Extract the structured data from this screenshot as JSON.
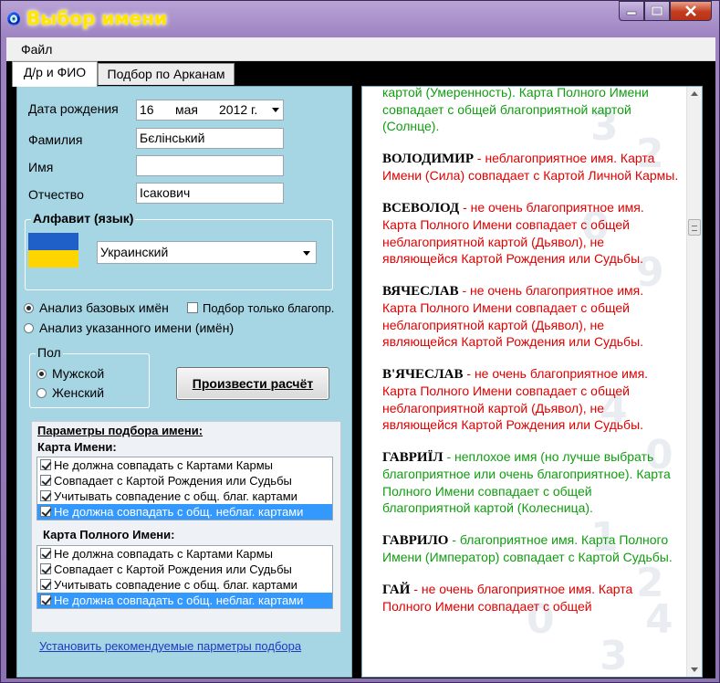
{
  "window": {
    "title": "Выбор имени",
    "icons": [
      "app-icon",
      "minimize-icon",
      "maximize-icon",
      "close-icon"
    ]
  },
  "menu": {
    "file": "Файл"
  },
  "tabs": [
    {
      "label": "Д/р и ФИО",
      "active": true
    },
    {
      "label": "Подбор по Арканам",
      "active": false
    }
  ],
  "form": {
    "birth_date_label": "Дата рождения",
    "birth_day": "16",
    "birth_month": "мая",
    "birth_year": "2012 г.",
    "surname_label": "Фамилия",
    "surname_value": "Бєлінський",
    "name_label": "Имя",
    "name_value": "",
    "patronymic_label": "Отчество",
    "patronymic_value": "Ісакович"
  },
  "alphabet": {
    "group_title": "Алфавит (язык)",
    "selected": "Украинский",
    "flag_colors": [
      "#1f5fc8",
      "#ffd500"
    ]
  },
  "analysis": {
    "option_base": "Анализ базовых имён",
    "option_base_selected": true,
    "only_favorable_label": "Подбор только благопр.",
    "only_favorable_checked": false,
    "option_specified": "Анализ указанного имени (имён)",
    "option_specified_selected": false
  },
  "gender": {
    "group_title": "Пол",
    "male": "Мужской",
    "male_selected": true,
    "female": "Женский",
    "female_selected": false
  },
  "calculate_button": "Произвести расчёт",
  "params": {
    "title": "Параметры подбора имени:",
    "name_card_title": "Карта Имени:",
    "name_card_options": [
      {
        "label": "Не должна совпадать с Картами Кармы",
        "checked": true,
        "selected": false
      },
      {
        "label": "Совпадает с Картой Рождения или Судьбы",
        "checked": true,
        "selected": false
      },
      {
        "label": "Учитывать совпадение с общ. благ. картами",
        "checked": true,
        "selected": false
      },
      {
        "label": "Не должна совпадать с общ. неблаг. картами",
        "checked": true,
        "selected": true
      }
    ],
    "full_name_card_title": "Карта Полного Имени:",
    "full_name_card_options": [
      {
        "label": "Не должна совпадать с Картами Кармы",
        "checked": true,
        "selected": false
      },
      {
        "label": "Совпадает с Картой Рождения или Судьбы",
        "checked": true,
        "selected": false
      },
      {
        "label": "Учитывать совпадение с общ. благ. картами",
        "checked": true,
        "selected": false
      },
      {
        "label": "Не должна совпадать с общ. неблаг. картами",
        "checked": true,
        "selected": true
      }
    ],
    "recommended_link": "Установить рекомендуемые парметры подбора"
  },
  "results": {
    "intro": "картой (Умеренность). Карта Полного Имени совпадает с общей благоприятной картой (Солнце).",
    "intro_color": "green",
    "entries": [
      {
        "name": "ВОЛОДИМИР",
        "text": " - неблагоприятное имя. Карта Имени (Сила) совпадает с Картой Личной Кармы.",
        "color": "red"
      },
      {
        "name": "ВСЕВОЛОД",
        "text": " - не очень благоприятное имя. Карта Полного Имени совпадает с общей неблагоприятной картой (Дьявол), не являющейся Картой Рождения или Судьбы.",
        "color": "red"
      },
      {
        "name": "ВЯЧЕСЛАВ",
        "text": " - не очень благоприятное имя. Карта Полного Имени совпадает с общей неблагоприятной картой (Дьявол), не являющейся Картой Рождения или Судьбы.",
        "color": "red"
      },
      {
        "name": "В'ЯЧЕСЛАВ",
        "text": " - не очень благоприятное имя. Карта Полного Имени совпадает с общей неблагоприятной картой (Дьявол), не являющейся Картой Рождения или Судьбы.",
        "color": "red"
      },
      {
        "name": "ГАВРИЇЛ",
        "text": " - неплохое имя (но лучше выбрать благоприятное или очень благоприятное). Карта Полного Имени совпадает с общей благоприятной картой (Колесница).",
        "color": "green"
      },
      {
        "name": "ГАВРИЛО",
        "text": " - благоприятное имя. Карта Полного Имени (Император) совпадает с Картой Судьбы.",
        "color": "green"
      },
      {
        "name": "ГАЙ",
        "text": " - не очень благоприятное имя. Карта Полного Имени совпадает с общей",
        "color": "red"
      }
    ]
  }
}
